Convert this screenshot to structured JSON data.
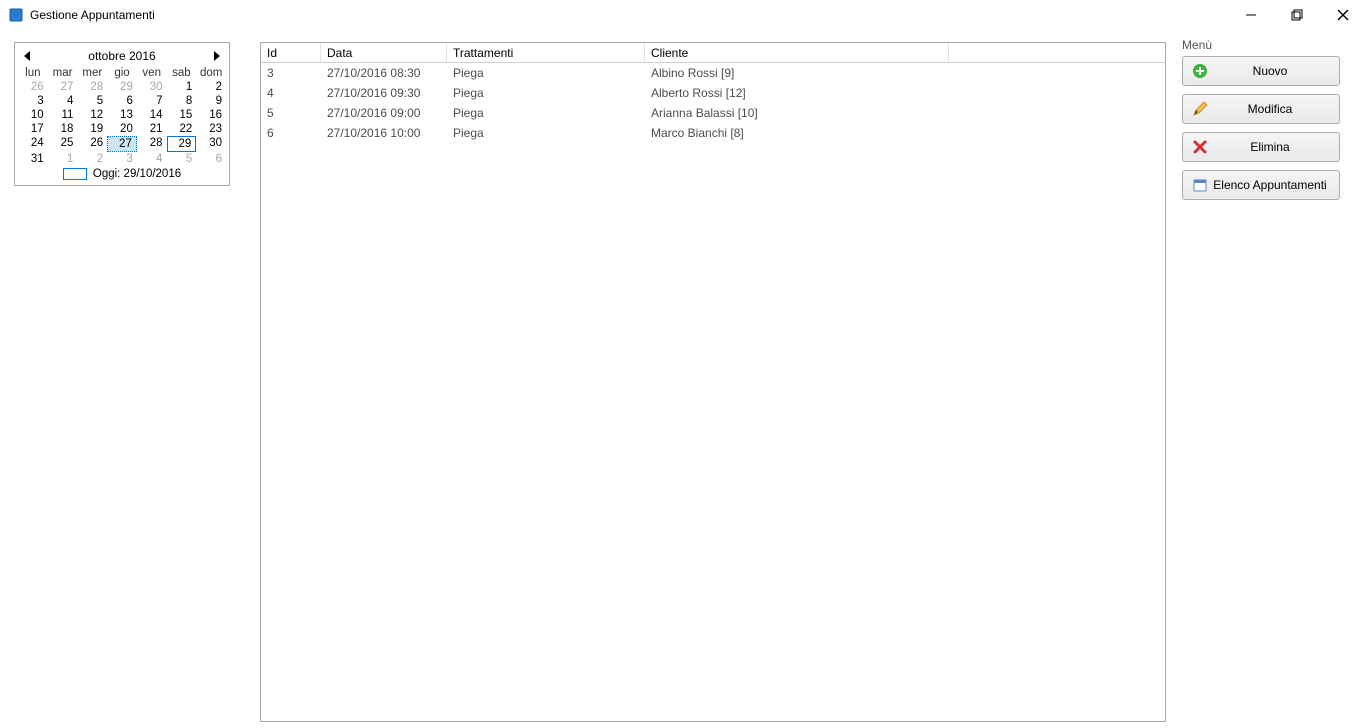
{
  "window": {
    "title": "Gestione Appuntamenti"
  },
  "calendar": {
    "title": "ottobre 2016",
    "daynames": [
      "lun",
      "mar",
      "mer",
      "gio",
      "ven",
      "sab",
      "dom"
    ],
    "weeks": [
      [
        {
          "n": "26",
          "other": true
        },
        {
          "n": "27",
          "other": true
        },
        {
          "n": "28",
          "other": true
        },
        {
          "n": "29",
          "other": true
        },
        {
          "n": "30",
          "other": true
        },
        {
          "n": "1"
        },
        {
          "n": "2"
        }
      ],
      [
        {
          "n": "3"
        },
        {
          "n": "4"
        },
        {
          "n": "5"
        },
        {
          "n": "6"
        },
        {
          "n": "7"
        },
        {
          "n": "8"
        },
        {
          "n": "9"
        }
      ],
      [
        {
          "n": "10"
        },
        {
          "n": "11"
        },
        {
          "n": "12"
        },
        {
          "n": "13"
        },
        {
          "n": "14"
        },
        {
          "n": "15"
        },
        {
          "n": "16"
        }
      ],
      [
        {
          "n": "17"
        },
        {
          "n": "18"
        },
        {
          "n": "19"
        },
        {
          "n": "20"
        },
        {
          "n": "21"
        },
        {
          "n": "22"
        },
        {
          "n": "23"
        }
      ],
      [
        {
          "n": "24"
        },
        {
          "n": "25"
        },
        {
          "n": "26"
        },
        {
          "n": "27",
          "selected": true
        },
        {
          "n": "28"
        },
        {
          "n": "29",
          "today": true
        },
        {
          "n": "30"
        }
      ],
      [
        {
          "n": "31"
        },
        {
          "n": "1",
          "other": true
        },
        {
          "n": "2",
          "other": true
        },
        {
          "n": "3",
          "other": true
        },
        {
          "n": "4",
          "other": true
        },
        {
          "n": "5",
          "other": true
        },
        {
          "n": "6",
          "other": true
        }
      ]
    ],
    "today_label": "Oggi: 29/10/2016"
  },
  "table": {
    "headers": [
      "Id",
      "Data",
      "Trattamenti",
      "Cliente",
      ""
    ],
    "rows": [
      {
        "id": "3",
        "data": "27/10/2016 08:30",
        "trattamenti": "Piega",
        "cliente": "Albino Rossi [9]"
      },
      {
        "id": "4",
        "data": "27/10/2016 09:30",
        "trattamenti": "Piega",
        "cliente": "Alberto Rossi [12]"
      },
      {
        "id": "5",
        "data": "27/10/2016 09:00",
        "trattamenti": "Piega",
        "cliente": "Arianna Balassi [10]"
      },
      {
        "id": "6",
        "data": "27/10/2016 10:00",
        "trattamenti": "Piega",
        "cliente": "Marco Bianchi [8]"
      }
    ]
  },
  "menu": {
    "title": "Menù",
    "nuovo": "Nuovo",
    "modifica": "Modifica",
    "elimina": "Elimina",
    "elenco": "Elenco Appuntamenti"
  }
}
